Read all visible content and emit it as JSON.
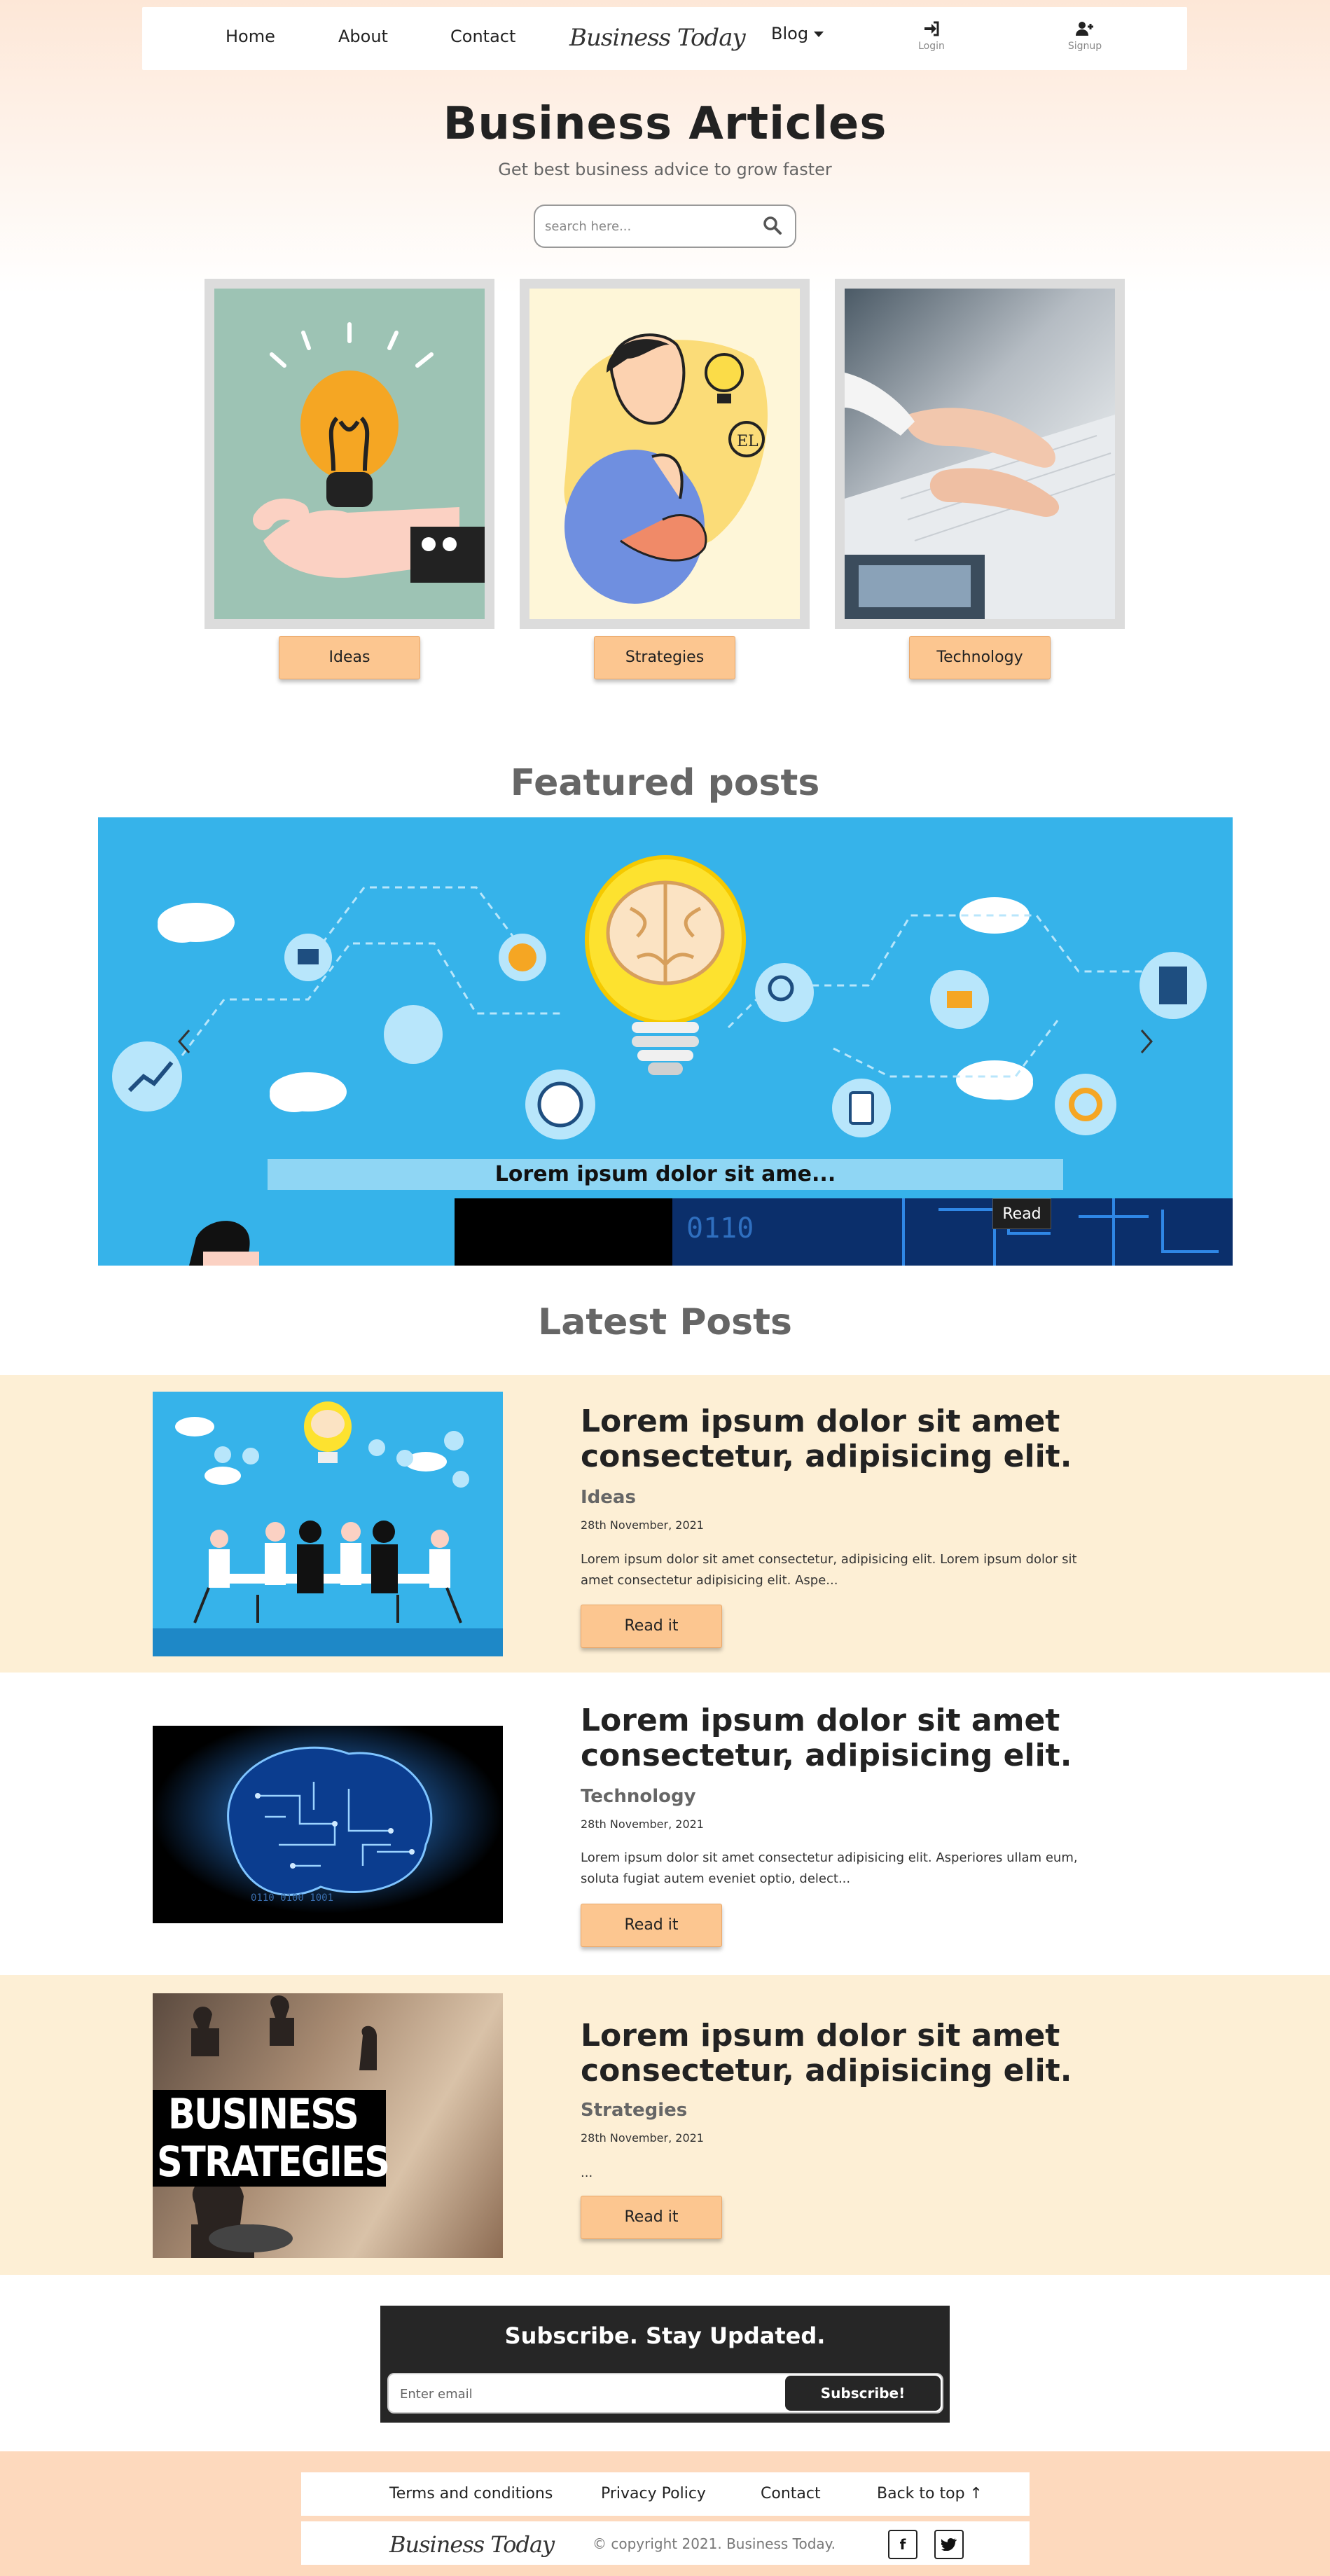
{
  "navbar": {
    "home": "Home",
    "about": "About",
    "contact": "Contact",
    "brand": "Business Today",
    "blog": "Blog",
    "login": "Login",
    "signup": "Signup"
  },
  "header": {
    "title": "Business Articles",
    "subtitle": "Get best business advice to grow faster",
    "search_placeholder": "search here..."
  },
  "categories": [
    {
      "label": "Ideas"
    },
    {
      "label": "Strategies"
    },
    {
      "label": "Technology"
    }
  ],
  "featured": {
    "heading": "Featured posts",
    "caption": "Lorem ipsum dolor sit ame...",
    "read_label": "Read"
  },
  "latest": {
    "heading": "Latest Posts",
    "posts": [
      {
        "title": "Lorem ipsum dolor sit amet consectetur, adipisicing elit.",
        "category": "Ideas",
        "date": "28th November, 2021",
        "excerpt": "Lorem ipsum dolor sit amet consectetur, adipisicing elit. Lorem ipsum dolor sit amet consectetur adipisicing elit. Aspe...",
        "button": "Read it"
      },
      {
        "title": "Lorem ipsum dolor sit amet consectetur, adipisicing elit.",
        "category": "Technology",
        "date": "28th November, 2021",
        "excerpt": "Lorem ipsum dolor sit amet consectetur adipisicing elit. Asperiores ullam eum, soluta fugiat autem eveniet optio, delect...",
        "button": "Read it"
      },
      {
        "title": "Lorem ipsum dolor sit amet consectetur, adipisicing elit.",
        "category": "Strategies",
        "date": "28th November, 2021",
        "excerpt": "...",
        "button": "Read it",
        "image_text_1": "BUSINESS",
        "image_text_2": "STRATEGIES"
      }
    ]
  },
  "subscribe": {
    "title": "Subscribe. Stay Updated.",
    "placeholder": "Enter email",
    "button": "Subscribe!"
  },
  "footer": {
    "terms": "Terms and conditions",
    "privacy": "Privacy Policy",
    "contact": "Contact",
    "back_to_top": "Back to top ↑",
    "brand": "Business Today",
    "copyright": "© copyright 2021. Business Today.",
    "facebook": "f",
    "twitter": "t"
  },
  "colors": {
    "accent_button": "#fcc690",
    "band_cream": "#fdefd5",
    "carousel_blue": "#36b3ea",
    "footer_peach": "#fdd9bd",
    "dark": "#262626"
  }
}
